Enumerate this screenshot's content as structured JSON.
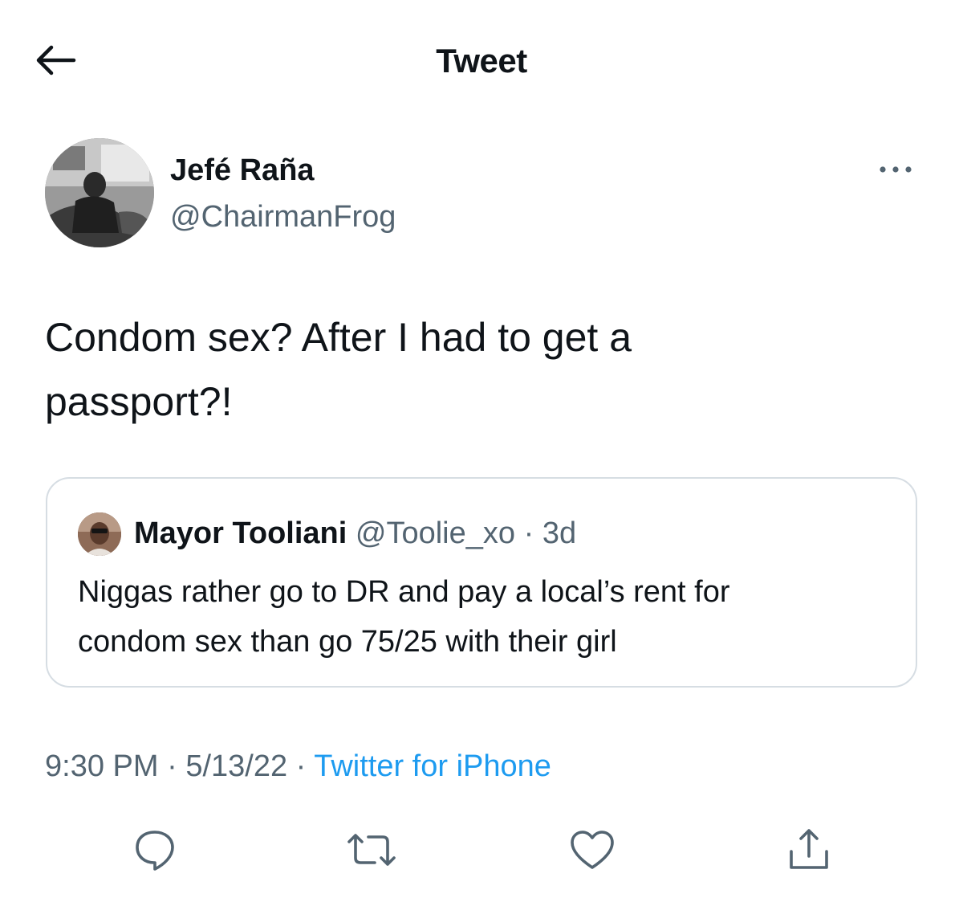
{
  "header": {
    "title": "Tweet",
    "back_icon": "arrow-left-icon"
  },
  "tweet": {
    "author": {
      "name": "Jefé Raña",
      "handle": "@ChairmanFrog"
    },
    "more_icon": "more-horizontal-icon",
    "text_line1": "Condom sex? After I had to get a",
    "text_line2": "passport?!",
    "quote": {
      "name": "Mayor Tooliani",
      "handle": "@Toolie_xo",
      "separator": "·",
      "time": "3d",
      "text_line1": "Niggas rather go to DR and pay a local’s rent for",
      "text_line2": "condom sex than go 75/25 with their girl"
    },
    "meta": {
      "time": "9:30 PM",
      "sep1": "·",
      "date": "5/13/22",
      "sep2": "·",
      "source": "Twitter for iPhone"
    }
  },
  "actions": [
    {
      "icon": "reply-icon"
    },
    {
      "icon": "retweet-icon"
    },
    {
      "icon": "like-icon"
    },
    {
      "icon": "share-icon"
    }
  ],
  "colors": {
    "text_primary": "#0f1419",
    "text_secondary": "#536471",
    "link": "#1d9bf0",
    "border": "#d6dde3",
    "icon": "#536471"
  }
}
